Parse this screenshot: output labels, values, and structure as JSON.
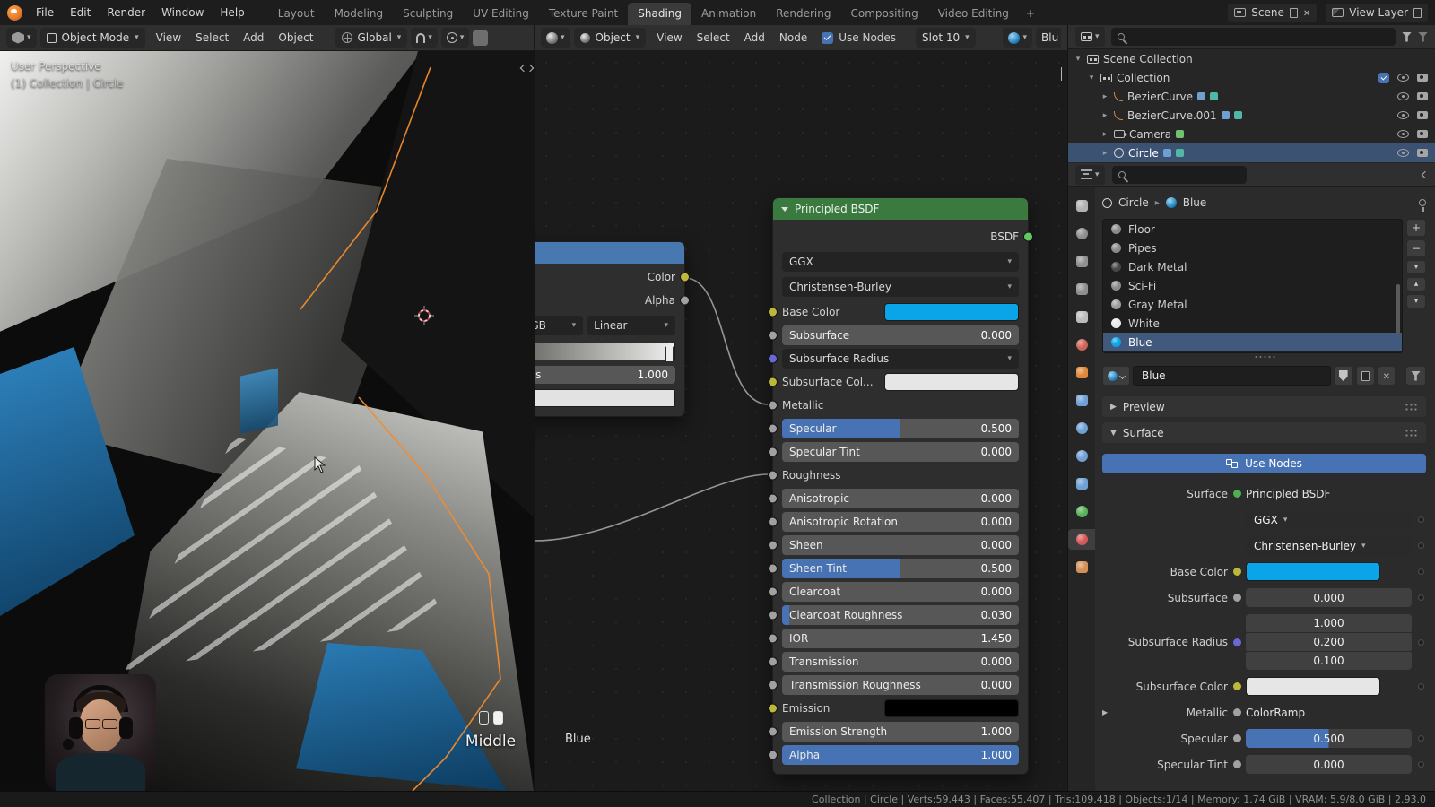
{
  "topbar": {
    "menus": [
      "File",
      "Edit",
      "Render",
      "Window",
      "Help"
    ],
    "tabs": [
      "Layout",
      "Modeling",
      "Sculpting",
      "UV Editing",
      "Texture Paint",
      "Shading",
      "Animation",
      "Rendering",
      "Compositing",
      "Video Editing"
    ],
    "active_tab": "Shading",
    "new_workspace": "+",
    "scene_label": "Scene",
    "view_layer_label": "View Layer"
  },
  "viewport_header": {
    "mode": "Object Mode",
    "menus": [
      "View",
      "Select",
      "Add",
      "Object"
    ],
    "orientation": "Global"
  },
  "shader_header": {
    "shader_type": "Object",
    "menus": [
      "View",
      "Select",
      "Add",
      "Node"
    ],
    "use_nodes_label": "Use Nodes",
    "slot_label": "Slot 10",
    "material_name": "Blu"
  },
  "viewport": {
    "view_label": "User Perspective",
    "context_label": "(1) Collection | Circle",
    "screencast_key": "Middle"
  },
  "node_editor": {
    "frame_label": "Blue",
    "colorramp": {
      "color_output": "Color",
      "alpha_output": "Alpha",
      "mode": "RGB",
      "interpolation": "Linear",
      "pos_label": "Pos",
      "pos_value": "1.000"
    },
    "principled": {
      "title": "Principled BSDF",
      "output_label": "BSDF",
      "distribution": "GGX",
      "subsurface_method": "Christensen-Burley",
      "rows": [
        {
          "label": "Base Color",
          "type": "color",
          "socket": "#bdb83a",
          "swatch": "#0aa5e8"
        },
        {
          "label": "Subsurface",
          "type": "value",
          "value": "0.000",
          "socket": "#a1a1a1"
        },
        {
          "label": "Subsurface Radius",
          "type": "dropdown",
          "socket": "#6868d7"
        },
        {
          "label": "Subsurface Col...",
          "type": "color",
          "socket": "#bdb83a",
          "swatch": "#e6e6e6"
        },
        {
          "label": "Metallic",
          "type": "linked",
          "socket": "#a1a1a1"
        },
        {
          "label": "Specular",
          "type": "slider",
          "value": "0.500",
          "fill": 0.5,
          "socket": "#a1a1a1"
        },
        {
          "label": "Specular Tint",
          "type": "value",
          "value": "0.000",
          "socket": "#a1a1a1"
        },
        {
          "label": "Roughness",
          "type": "linked",
          "socket": "#a1a1a1"
        },
        {
          "label": "Anisotropic",
          "type": "value",
          "value": "0.000",
          "socket": "#a1a1a1"
        },
        {
          "label": "Anisotropic Rotation",
          "type": "value",
          "value": "0.000",
          "socket": "#a1a1a1"
        },
        {
          "label": "Sheen",
          "type": "value",
          "value": "0.000",
          "socket": "#a1a1a1"
        },
        {
          "label": "Sheen Tint",
          "type": "slider",
          "value": "0.500",
          "fill": 0.5,
          "socket": "#a1a1a1"
        },
        {
          "label": "Clearcoat",
          "type": "value",
          "value": "0.000",
          "socket": "#a1a1a1"
        },
        {
          "label": "Clearcoat Roughness",
          "type": "slider",
          "value": "0.030",
          "fill": 0.03,
          "socket": "#a1a1a1"
        },
        {
          "label": "IOR",
          "type": "value",
          "value": "1.450",
          "socket": "#a1a1a1"
        },
        {
          "label": "Transmission",
          "type": "value",
          "value": "0.000",
          "socket": "#a1a1a1"
        },
        {
          "label": "Transmission Roughness",
          "type": "value",
          "value": "0.000",
          "socket": "#a1a1a1"
        },
        {
          "label": "Emission",
          "type": "color",
          "socket": "#bdb83a",
          "swatch": "#000000"
        },
        {
          "label": "Emission Strength",
          "type": "value",
          "value": "1.000",
          "socket": "#a1a1a1"
        },
        {
          "label": "Alpha",
          "type": "slider",
          "value": "1.000",
          "fill": 1.0,
          "socket": "#a1a1a1"
        }
      ]
    }
  },
  "outliner": {
    "rows": [
      {
        "label": "Scene Collection",
        "depth": 0,
        "icon": "coll",
        "expanded": true
      },
      {
        "label": "Collection",
        "depth": 1,
        "icon": "coll",
        "expanded": true,
        "checkbox": true,
        "eye": true,
        "cam": true
      },
      {
        "label": "BezierCurve",
        "depth": 2,
        "icon": "curve",
        "badges": true,
        "eye": true,
        "cam": true
      },
      {
        "label": "BezierCurve.001",
        "depth": 2,
        "icon": "curve",
        "badges": true,
        "eye": true,
        "cam": true
      },
      {
        "label": "Camera",
        "depth": 2,
        "icon": "camo",
        "data_badge": true,
        "eye": true,
        "cam": true
      },
      {
        "label": "Circle",
        "depth": 2,
        "icon": "ring",
        "selected": true,
        "badges": true,
        "eye": true,
        "cam": true
      }
    ]
  },
  "properties": {
    "breadcrumb": {
      "object": "Circle",
      "material": "Blue"
    },
    "nav_tabs": [
      {
        "name": "tool",
        "color": "#b2b2b2",
        "shape": "sq"
      },
      {
        "name": "render",
        "color": "#8f8f8f"
      },
      {
        "name": "output",
        "color": "#8f8f8f",
        "shape": "sq"
      },
      {
        "name": "view-layer",
        "color": "#8f8f8f",
        "shape": "sq"
      },
      {
        "name": "scene",
        "color": "#bcbcbc",
        "shape": "sq"
      },
      {
        "name": "world",
        "color": "#cc6659"
      },
      {
        "name": "object",
        "color": "#e0883a",
        "shape": "sq"
      },
      {
        "name": "modifiers",
        "color": "#6f9fd3",
        "shape": "sq"
      },
      {
        "name": "particles",
        "color": "#6f9fd3"
      },
      {
        "name": "physics",
        "color": "#6f9fd3"
      },
      {
        "name": "constraints",
        "color": "#6f9fd3",
        "shape": "sq"
      },
      {
        "name": "object-data",
        "color": "#58b158",
        "shape": "s q"
      },
      {
        "name": "material",
        "color": "#d35858",
        "active": true
      },
      {
        "name": "texture",
        "color": "#d38f58",
        "shape": "sq"
      }
    ],
    "slots": [
      {
        "label": "Floor",
        "color": "#8a8a8a"
      },
      {
        "label": "Pipes",
        "color": "#8a8a8a"
      },
      {
        "label": "Dark Metal",
        "color": "#474747"
      },
      {
        "label": "Sci-Fi",
        "color": "#8a8a8a"
      },
      {
        "label": "Gray Metal",
        "color": "#9d9d9d"
      },
      {
        "label": "White",
        "color": "#e8e8e8"
      },
      {
        "label": "Blue",
        "color": "#0aa5e8",
        "selected": true
      }
    ],
    "datablock_name": "Blue",
    "sections": {
      "preview": "Preview",
      "surface": "Surface"
    },
    "use_nodes_label": "Use Nodes",
    "surface_rows": [
      {
        "label": "Surface",
        "type": "flat",
        "value": "Principled BSDF",
        "socket": "#4fae4f"
      },
      {
        "label": "",
        "type": "dropdown",
        "value": "GGX",
        "deco": true
      },
      {
        "label": "",
        "type": "dropdown",
        "value": "Christensen-Burley",
        "deco": true
      },
      {
        "label": "Base Color",
        "type": "color",
        "swatch": "#0aa5e8",
        "socket": "#bdb83a",
        "deco": true
      },
      {
        "label": "Subsurface",
        "type": "value",
        "value": "0.000",
        "socket": "#a1a1a1",
        "deco": true
      },
      {
        "label": "Subsurface Radius",
        "type": "vector",
        "values": [
          "1.000",
          "0.200",
          "0.100"
        ],
        "socket": "#6868d7",
        "deco": true
      },
      {
        "label": "Subsurface Color",
        "type": "color",
        "swatch": "#e6e6e6",
        "socket": "#bdb83a",
        "deco": true
      },
      {
        "label": "Metallic",
        "type": "node_link",
        "value": "ColorRamp",
        "socket": "#a1a1a1",
        "expander": true
      },
      {
        "label": "Specular",
        "type": "slider",
        "value": "0.500",
        "fill": 0.5,
        "socket": "#a1a1a1",
        "deco": true
      },
      {
        "label": "Specular Tint",
        "type": "slider",
        "value": "0.000",
        "fill": 0,
        "socket": "#a1a1a1",
        "deco": true
      }
    ]
  },
  "statusbar": {
    "text": "Collection | Circle | Verts:59,443 | Faces:55,407 | Tris:109,418 | Objects:1/14 | Memory: 1.74 GiB | VRAM: 5.9/8.0 GiB | 2.93.0"
  }
}
